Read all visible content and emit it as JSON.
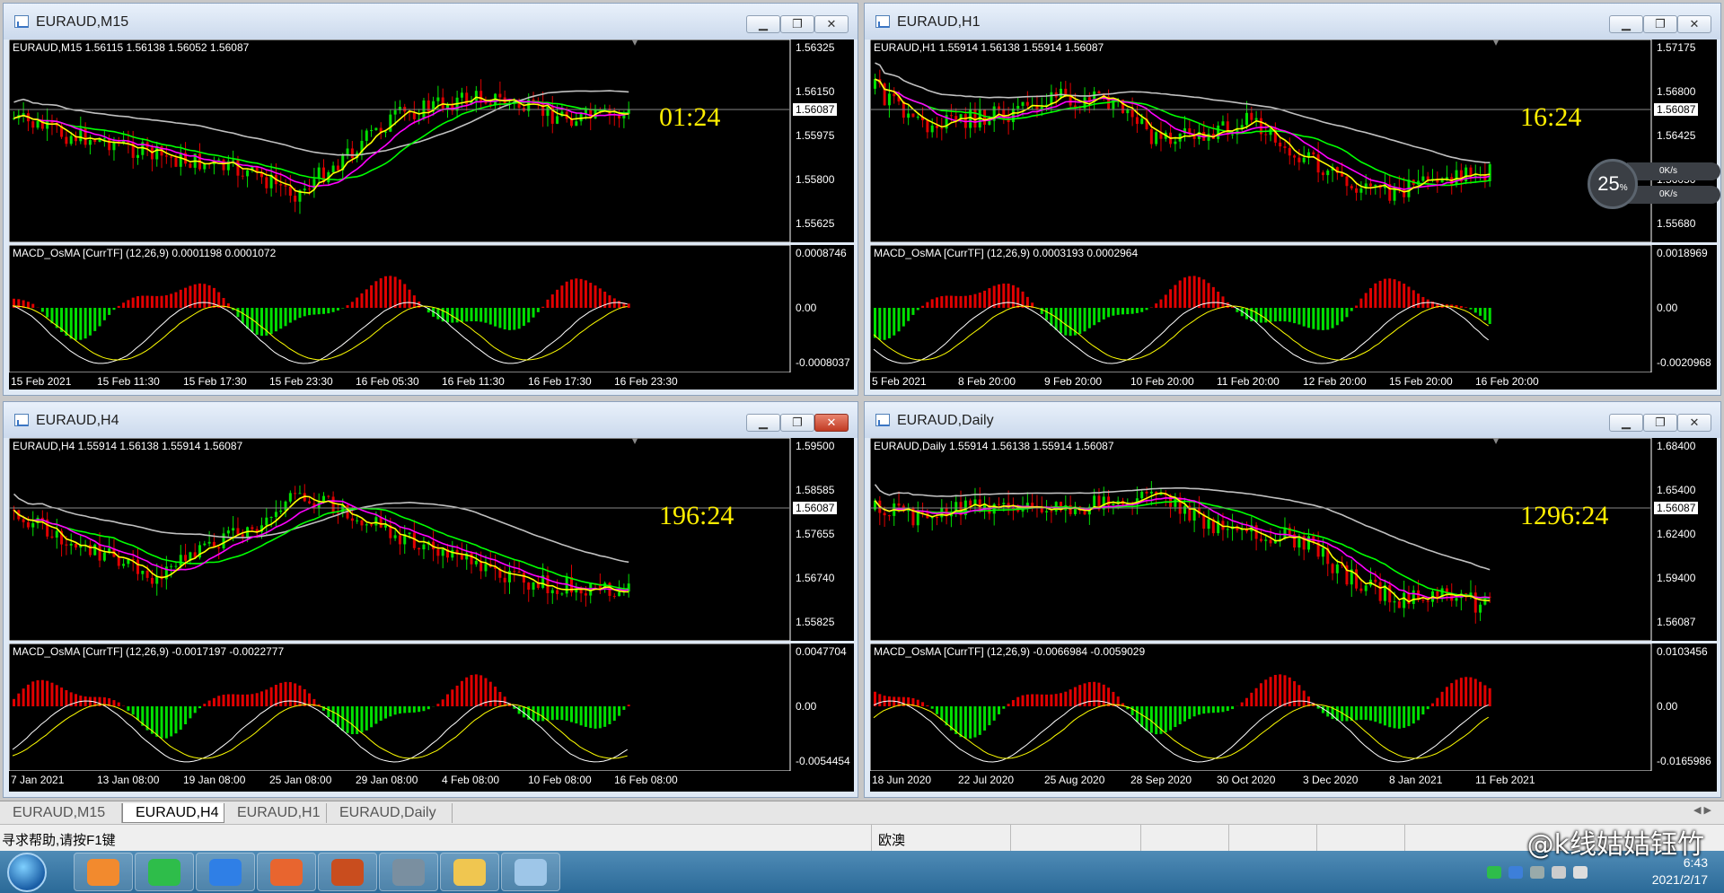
{
  "windows": [
    {
      "id": "m15",
      "title": "EURAUD,M15",
      "close_active": false,
      "info_line": "EURAUD,M15  1.56115 1.56138 1.56052 1.56087",
      "price_scale": [
        "1.56325",
        "1.56150",
        "1.55975",
        "1.55800",
        "1.55625"
      ],
      "price_tag": "1.56087",
      "timer": "01:24",
      "macd_info": "MACD_OsMA [CurrTF] (12,26,9) 0.0001198 0.0001072",
      "macd_scale": [
        "0.0008746",
        "0.00",
        "-0.0008037"
      ],
      "x_labels": [
        "15 Feb 2021",
        "15 Feb 11:30",
        "15 Feb 17:30",
        "15 Feb 23:30",
        "16 Feb 05:30",
        "16 Feb 11:30",
        "16 Feb 17:30",
        "16 Feb 23:30"
      ]
    },
    {
      "id": "h1",
      "title": "EURAUD,H1",
      "close_active": false,
      "info_line": "EURAUD,H1  1.55914 1.56138 1.55914 1.56087",
      "price_scale": [
        "1.57175",
        "1.56800",
        "1.56425",
        "1.56050",
        "1.55680"
      ],
      "price_tag": "1.56087",
      "timer": "16:24",
      "macd_info": "MACD_OsMA [CurrTF] (12,26,9) 0.0003193 0.0002964",
      "macd_scale": [
        "0.0018969",
        "0.00",
        "-0.0020968"
      ],
      "x_labels": [
        "5 Feb 2021",
        "8 Feb 20:00",
        "9 Feb 20:00",
        "10 Feb 20:00",
        "11 Feb 20:00",
        "12 Feb 20:00",
        "15 Feb 20:00",
        "16 Feb 20:00"
      ]
    },
    {
      "id": "h4",
      "title": "EURAUD,H4",
      "close_active": true,
      "info_line": "EURAUD,H4  1.55914 1.56138 1.55914 1.56087",
      "price_scale": [
        "1.59500",
        "1.58585",
        "1.57655",
        "1.56740",
        "1.55825"
      ],
      "price_tag": "1.56087",
      "timer": "196:24",
      "macd_info": "MACD_OsMA [CurrTF] (12,26,9) -0.0017197 -0.0022777",
      "macd_scale": [
        "0.0047704",
        "0.00",
        "-0.0054454"
      ],
      "x_labels": [
        "7 Jan 2021",
        "13 Jan 08:00",
        "19 Jan 08:00",
        "25 Jan 08:00",
        "29 Jan 08:00",
        "4 Feb 08:00",
        "10 Feb 08:00",
        "16 Feb 08:00"
      ]
    },
    {
      "id": "daily",
      "title": "EURAUD,Daily",
      "close_active": false,
      "info_line": "EURAUD,Daily  1.55914 1.56138 1.55914 1.56087",
      "price_scale": [
        "1.68400",
        "1.65400",
        "1.62400",
        "1.59400",
        "1.56087"
      ],
      "price_tag": "1.56087",
      "timer": "1296:24",
      "macd_info": "MACD_OsMA [CurrTF] (12,26,9) -0.0066984 -0.0059029",
      "macd_scale": [
        "0.0103456",
        "0.00",
        "-0.0165986"
      ],
      "x_labels": [
        "18 Jun 2020",
        "22 Jul 2020",
        "25 Aug 2020",
        "28 Sep 2020",
        "30 Oct 2020",
        "3 Dec 2020",
        "8 Jan 2021",
        "11 Feb 2021"
      ]
    }
  ],
  "window_controls": {
    "minimize": "▁",
    "restore": "❐",
    "close": "✕"
  },
  "tabs": [
    "EURAUD,M15",
    "EURAUD,H4",
    "EURAUD,H1",
    "EURAUD,Daily"
  ],
  "active_tab": "EURAUD,H4",
  "tab_arrows": "◀ ▶",
  "status": {
    "help": "寻求帮助,请按F1键",
    "region": "欧澳"
  },
  "taskbar": {
    "apps": [
      "orange-app-icon",
      "wechat-icon",
      "feishu-icon",
      "firefox-icon",
      "game-icon",
      "qr-tool-icon",
      "folder-icon",
      "notepad-icon"
    ],
    "clock_time": "6:43",
    "clock_date": "2021/2/17"
  },
  "watermark": "@k线姑姑钰竹",
  "net_widget": {
    "percent": "25",
    "percent_unit": "%",
    "up": "0K/s",
    "down": "0K/s"
  },
  "colors": {
    "bull": "#00e000",
    "bear": "#e00000",
    "ma_fast": "#ffff00",
    "ma_mid": "#ff00ff",
    "ma_slow": "#00ff00",
    "ma_long": "#c0c0c0",
    "timer": "#ffee00"
  }
}
